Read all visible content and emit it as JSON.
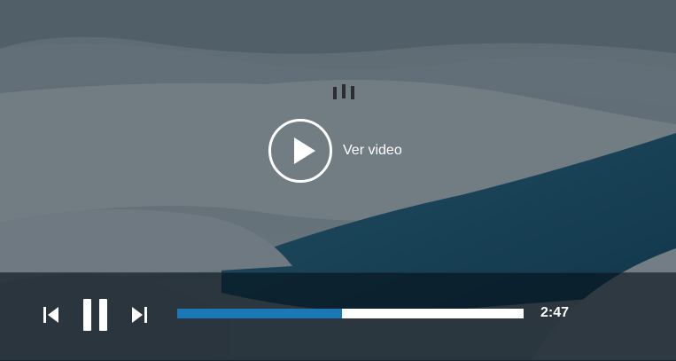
{
  "player": {
    "play_label": "Ver video",
    "time": "2:47",
    "progress_fraction": 0.475,
    "accent_color": "#1a78b4"
  },
  "icons": {
    "play": "play-icon",
    "previous": "skip-previous-icon",
    "pause": "pause-icon",
    "next": "skip-next-icon"
  }
}
